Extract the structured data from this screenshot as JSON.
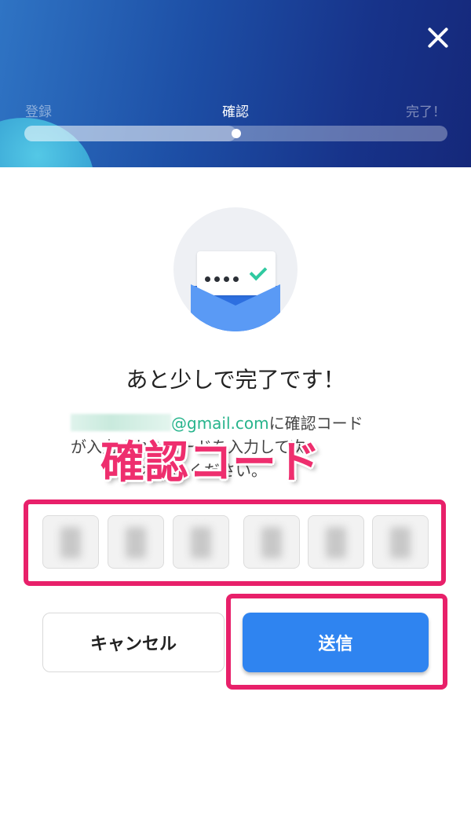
{
  "colors": {
    "header_start": "#2f74c4",
    "header_end": "#15287a",
    "accent_green": "#27b48c",
    "primary_button": "#2f84f0",
    "annotation": "#e8206a"
  },
  "header": {
    "close_icon": "close-icon",
    "steps": [
      "登録",
      "確認",
      "完了！"
    ],
    "active_step": 1,
    "progress_fraction": 0.5
  },
  "illustration": {
    "icon": "envelope-code-icon"
  },
  "main": {
    "title": "あと少しで完了です！",
    "email_domain": "@gmail.com",
    "desc_line1_suffix": "に確認コード",
    "desc_line2": "が入力されたコードを入力して次",
    "desc_line3": "へお進みください。"
  },
  "annotation": {
    "label": "確認コード"
  },
  "code_inputs": [
    "",
    "",
    "",
    "",
    "",
    ""
  ],
  "buttons": {
    "cancel": "キャンセル",
    "send": "送信"
  }
}
